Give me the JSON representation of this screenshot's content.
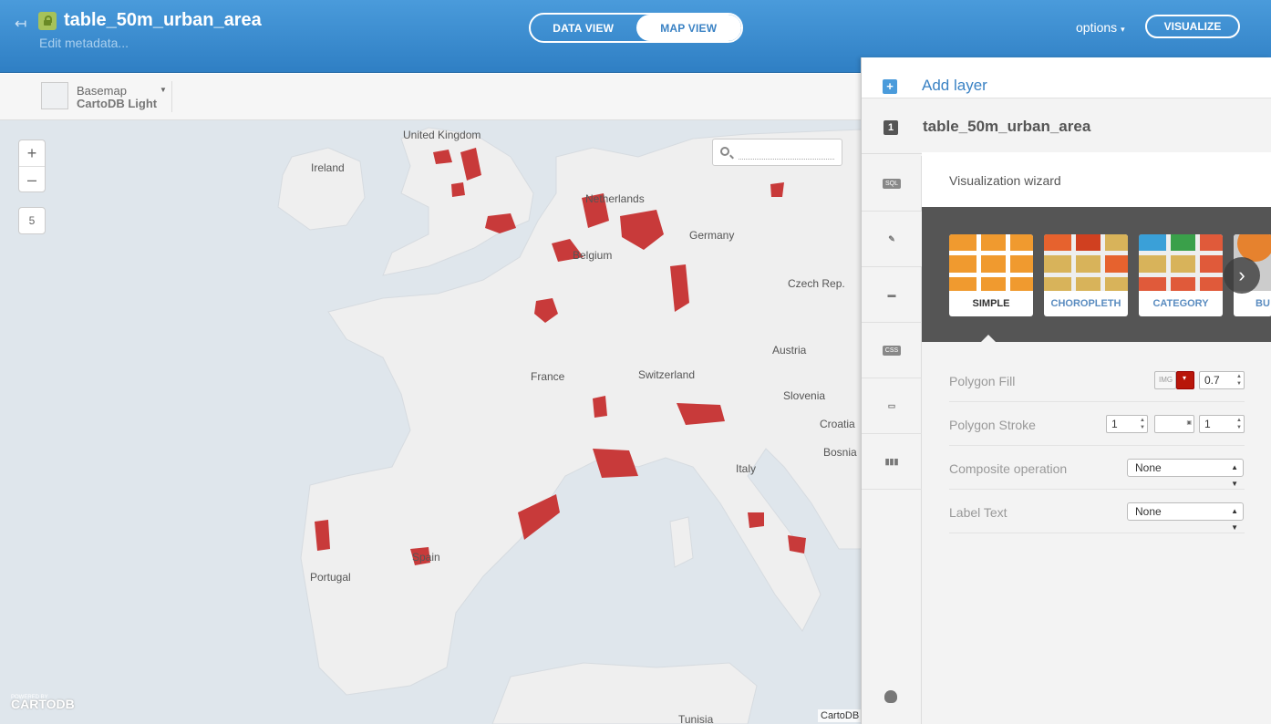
{
  "header": {
    "table_title": "table_50m_urban_area",
    "edit_metadata": "Edit metadata...",
    "view_tabs": [
      "DATA VIEW",
      "MAP VIEW"
    ],
    "active_view": "MAP VIEW",
    "options_label": "options",
    "visualize_label": "VISUALIZE"
  },
  "basemap": {
    "label": "Basemap",
    "value": "CartoDB Light"
  },
  "map": {
    "zoom_in": "+",
    "zoom_out": "–",
    "zoom_level": "5",
    "search_placeholder": "",
    "attribution": "CartoDB",
    "logo_text": "CARTODB",
    "logo_powered": "POWERED BY",
    "labels": [
      "United Kingdom",
      "Ireland",
      "Netherlands",
      "Belgium",
      "Germany",
      "Czech Rep.",
      "France",
      "Switzerland",
      "Austria",
      "Slovenia",
      "Croatia",
      "Bosnia",
      "Italy",
      "Spain",
      "Portugal",
      "Tunisia"
    ],
    "land_color": "#efefef",
    "water_color": "#dfe6ec",
    "polygon_color": "#c83a3a"
  },
  "panel": {
    "add_layer_label": "Add layer",
    "layer_number": "1",
    "layer_name": "table_50m_urban_area",
    "side_tabs": [
      "SQL",
      "wizard",
      "infowindow",
      "CSS",
      "legend",
      "filters"
    ],
    "wizard_title": "Visualization wizard",
    "wizard_types": [
      "SIMPLE",
      "CHOROPLETH",
      "CATEGORY",
      "BU"
    ],
    "selected_type": "SIMPLE",
    "props": {
      "polygon_fill_label": "Polygon Fill",
      "polygon_fill_img": "IMG",
      "polygon_fill_opacity": "0.7",
      "polygon_fill_color": "#b81609",
      "polygon_stroke_label": "Polygon Stroke",
      "polygon_stroke_width": "1",
      "polygon_stroke_opacity": "1",
      "composite_label": "Composite operation",
      "composite_value": "None",
      "label_text_label": "Label Text",
      "label_text_value": "None"
    }
  }
}
